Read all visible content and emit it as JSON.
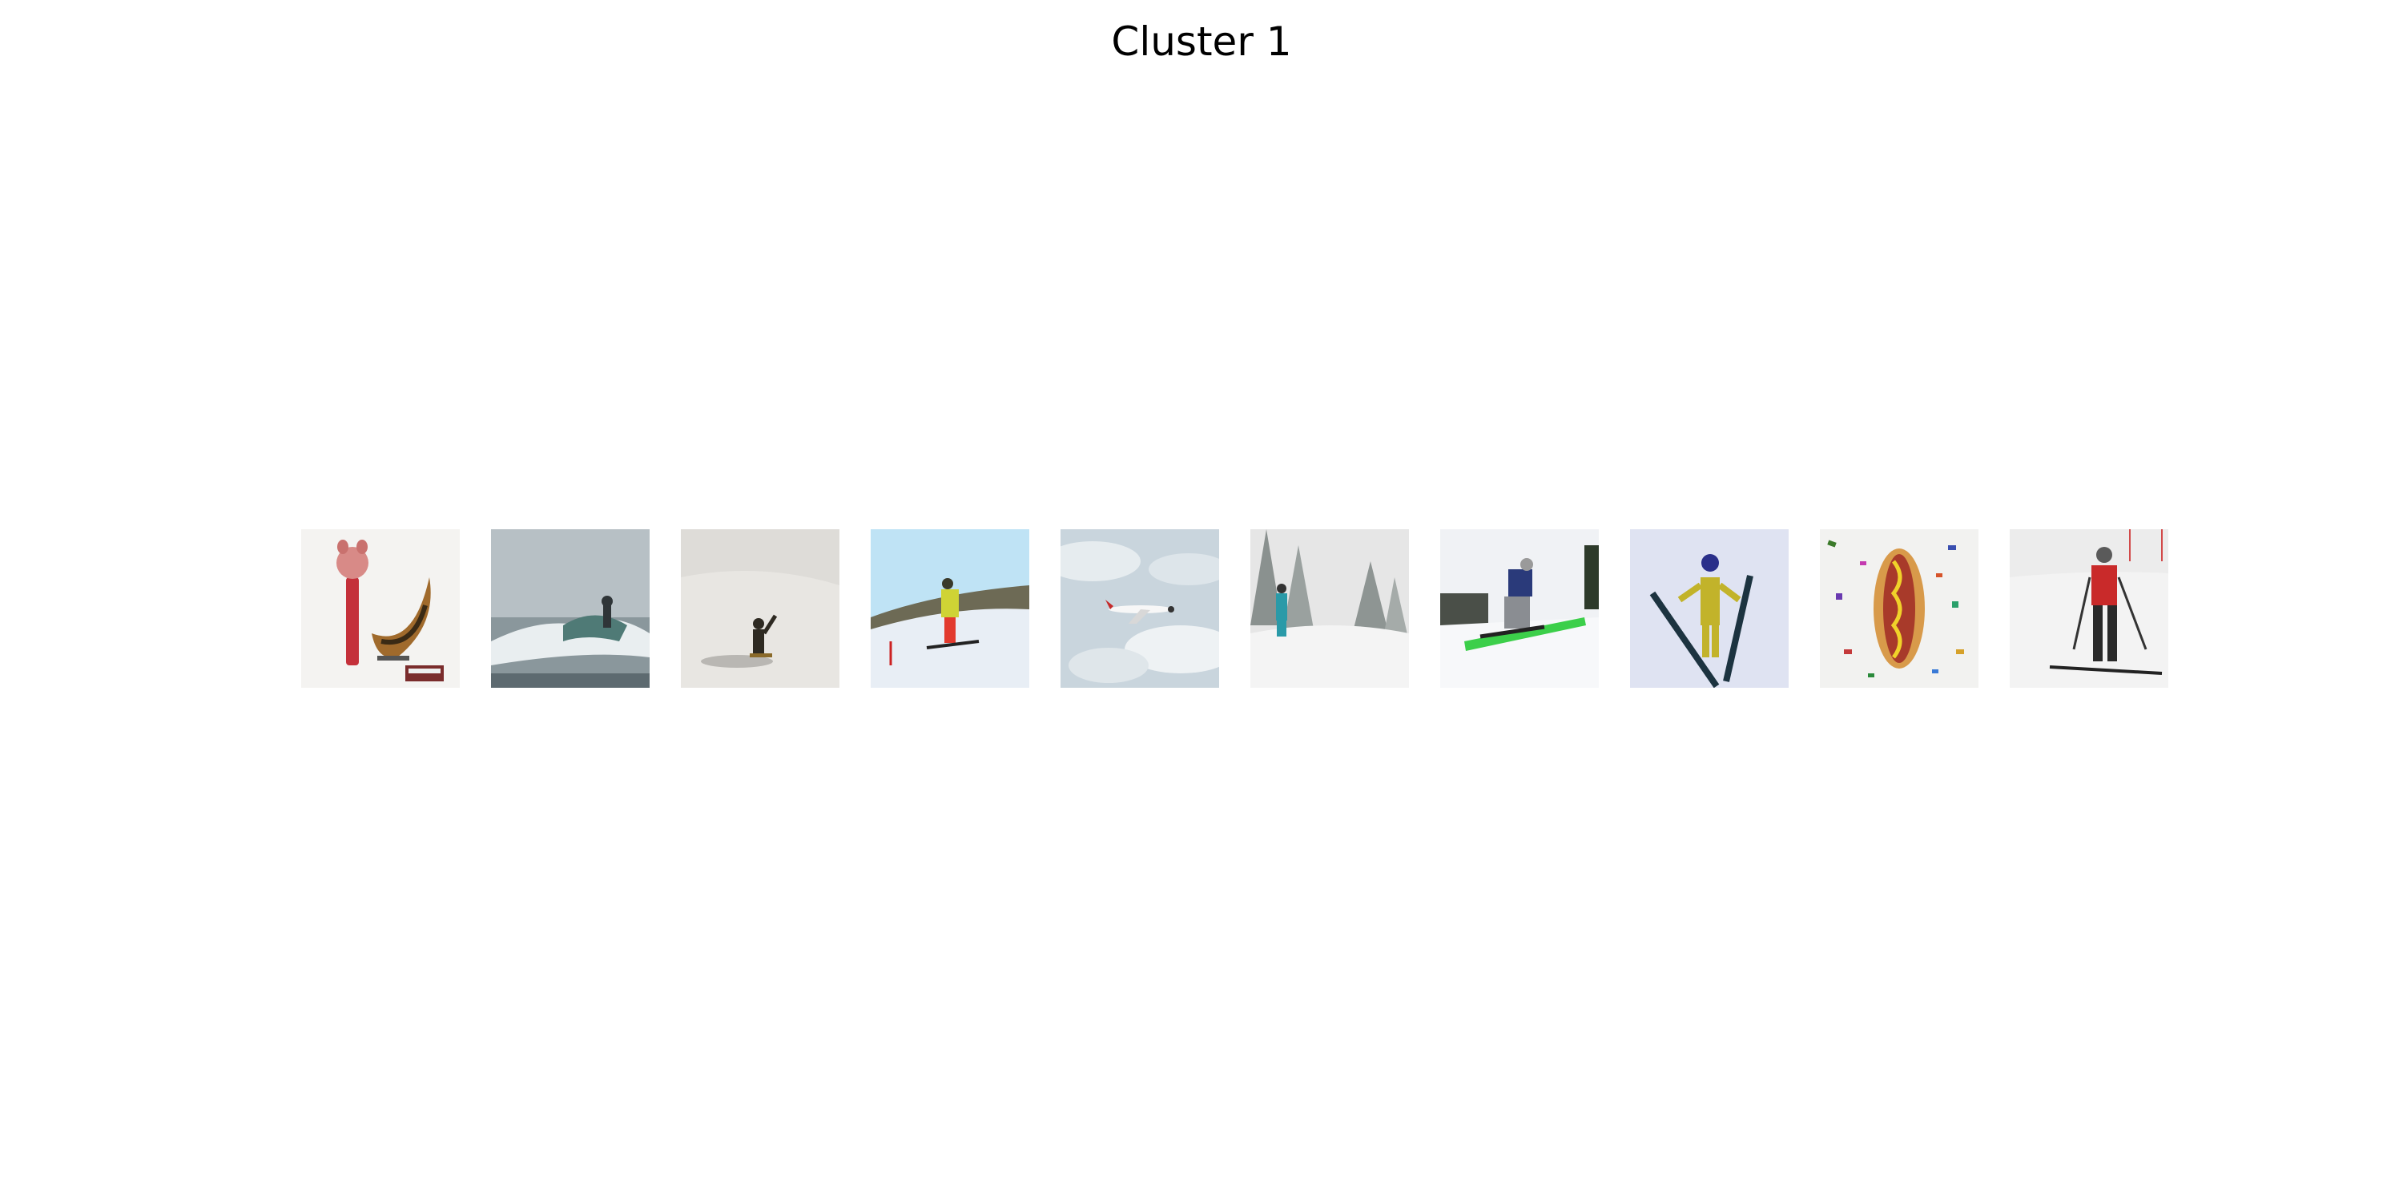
{
  "title": "Cluster 1",
  "thumbnails": [
    {
      "subject": "banana-sculpture-with-pig-mask",
      "background": "#f4f3f1"
    },
    {
      "subject": "surfer-on-wave",
      "background": "#b7c0c5"
    },
    {
      "subject": "snowboarder-on-slope",
      "background": "#dedcd8"
    },
    {
      "subject": "skier-yellow-jacket-on-hill",
      "background": "#bfe3f5"
    },
    {
      "subject": "airplane-in-cloudy-sky",
      "background": "#c9d5dd"
    },
    {
      "subject": "skier-in-snowy-forest",
      "background": "#e6e6e6"
    },
    {
      "subject": "snowboarder-on-rail",
      "background": "#f0f2f5"
    },
    {
      "subject": "ski-jumper-in-air",
      "background": "#dfe3f2"
    },
    {
      "subject": "hot-dog-with-confetti",
      "background": "#f2f2f0"
    },
    {
      "subject": "skier-red-jacket",
      "background": "#ececec"
    }
  ]
}
